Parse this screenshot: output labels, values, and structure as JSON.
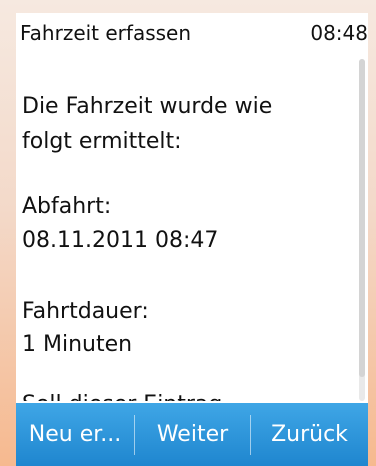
{
  "status_bar": {
    "title": "Fahrzeit erfassen",
    "time": "08:48"
  },
  "content": {
    "line1": "Die Fahrzeit wurde wie",
    "line2": "folgt ermittelt:",
    "departure_label": "Abfahrt:",
    "departure_value": "08.11.2011 08:47",
    "duration_label": "Fahrtdauer:",
    "duration_value": "1 Minuten",
    "question_partial": "Soll dieser Eintrag"
  },
  "softkeys": {
    "left": "Neu er...",
    "middle": "Weiter",
    "right": "Zurück"
  },
  "colors": {
    "softkey_bar": "#2b95dc",
    "background_accent": "#f6b98f"
  }
}
